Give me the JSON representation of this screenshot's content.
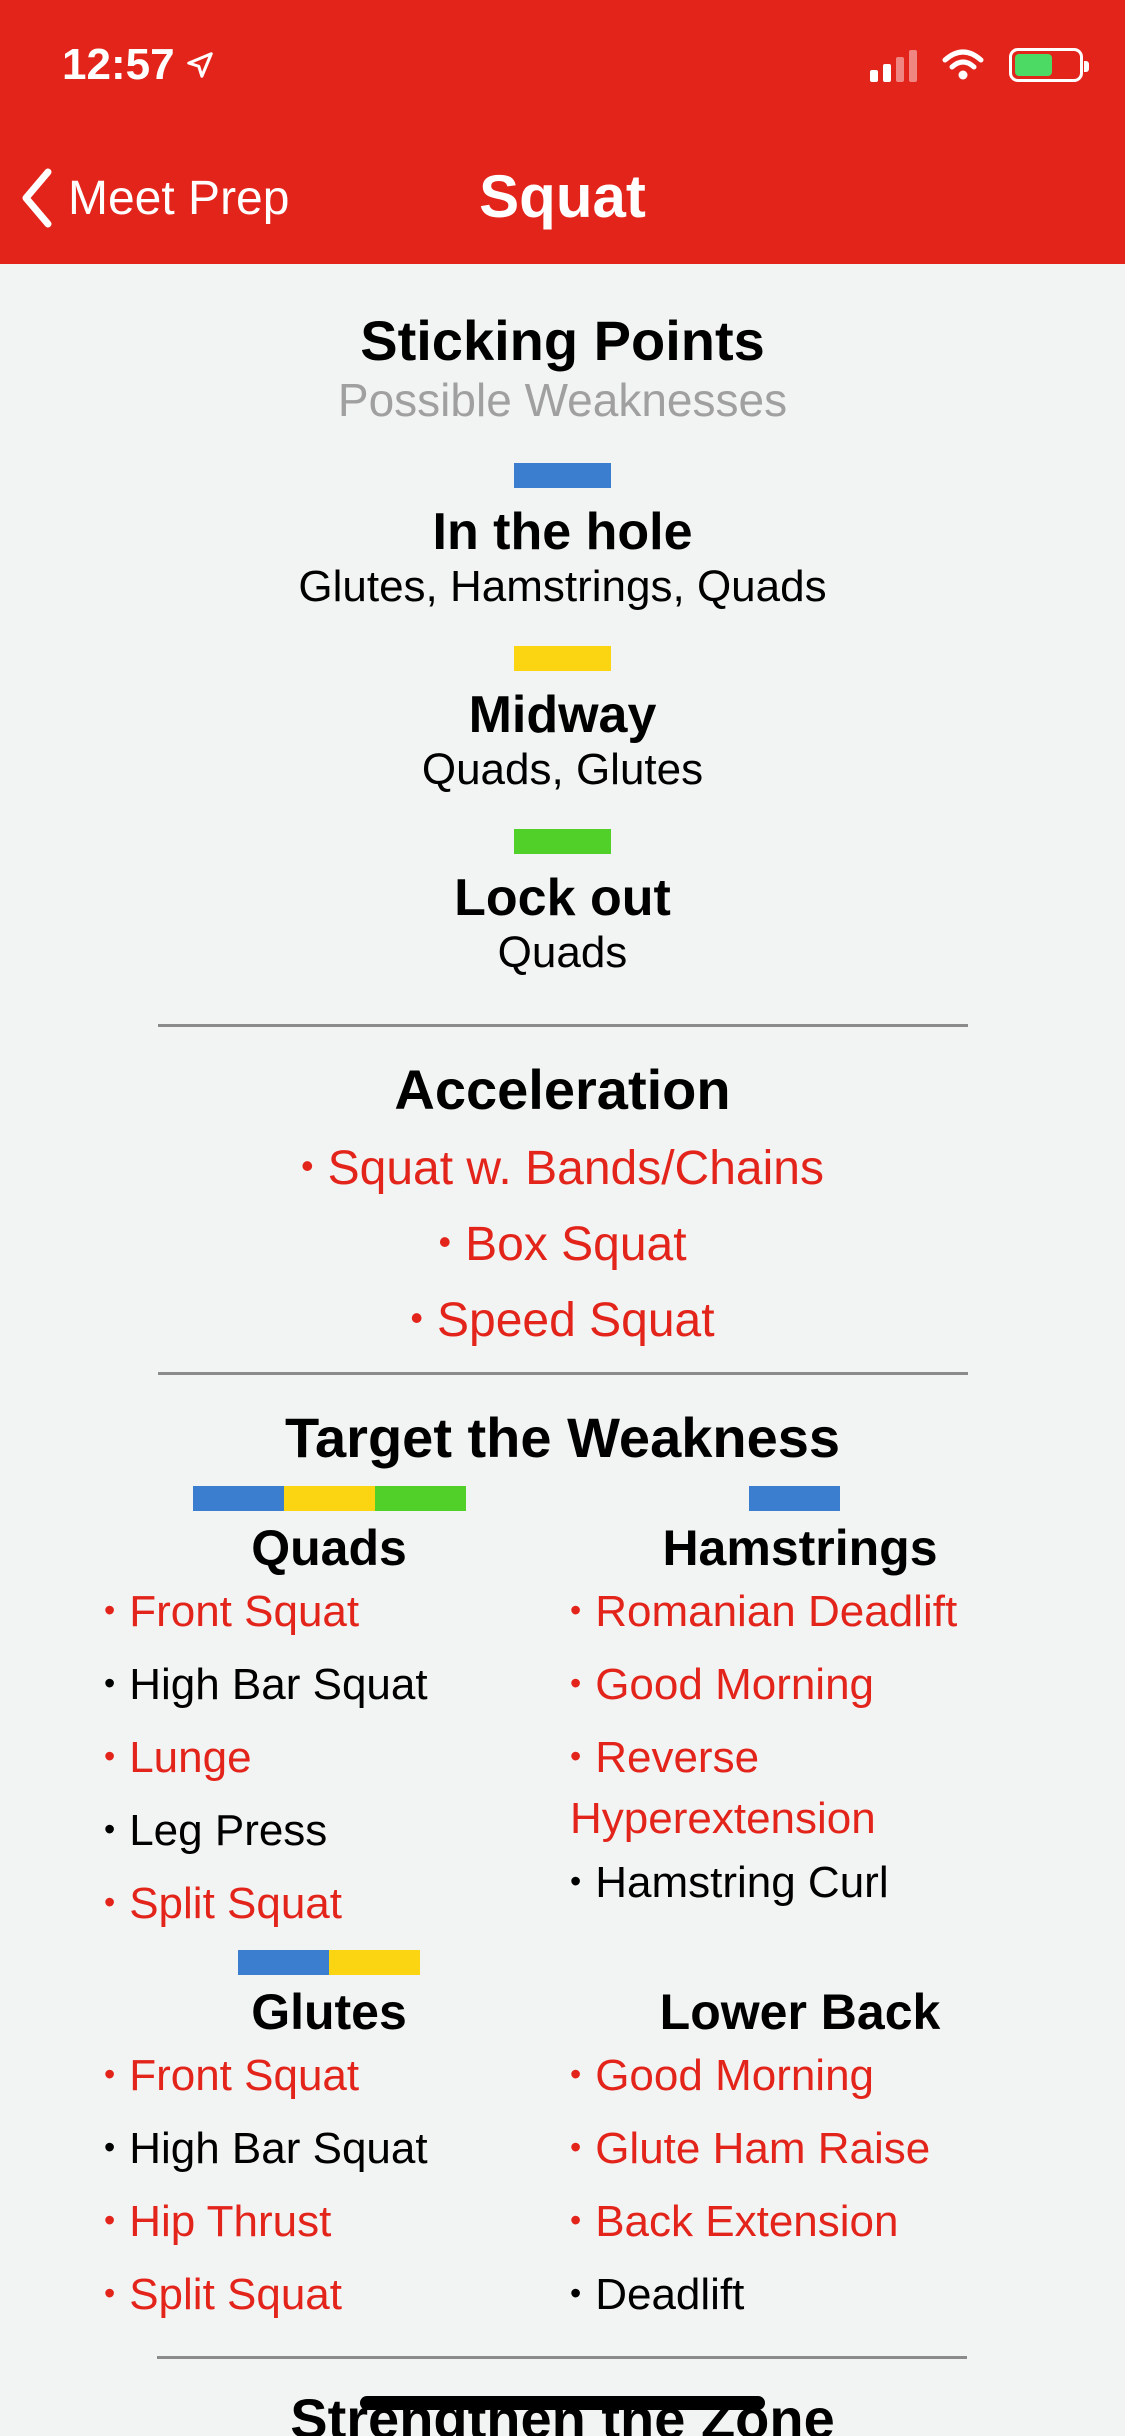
{
  "status_bar": {
    "time": "12:57"
  },
  "nav": {
    "back_label": "Meet Prep",
    "title": "Squat"
  },
  "sticking_points": {
    "title": "Sticking Points",
    "subtitle": "Possible Weaknesses",
    "phases": [
      {
        "name": "In the hole",
        "muscles": "Glutes, Hamstrings, Quads",
        "color": "#3b7dcf"
      },
      {
        "name": "Midway",
        "muscles": "Quads, Glutes",
        "color": "#fbd512"
      },
      {
        "name": "Lock out",
        "muscles": "Quads",
        "color": "#51d02a"
      }
    ]
  },
  "acceleration": {
    "title": "Acceleration",
    "items": [
      "Squat w. Bands/Chains",
      "Box Squat",
      "Speed Squat"
    ]
  },
  "target": {
    "title": "Target the Weakness",
    "quads": {
      "title": "Quads",
      "items": [
        "Front Squat",
        "High Bar Squat",
        "Lunge",
        "Leg Press",
        "Split Squat"
      ]
    },
    "hamstrings": {
      "title": "Hamstrings",
      "items": [
        "Romanian Deadlift",
        "Good Morning",
        "Reverse",
        "Hyperextension",
        "Hamstring Curl"
      ]
    },
    "glutes": {
      "title": "Glutes",
      "items": [
        "Front Squat",
        "High Bar Squat",
        "Hip Thrust",
        "Split Squat"
      ]
    },
    "lower_back": {
      "title": "Lower Back",
      "items": [
        "Good Morning",
        "Glute Ham Raise",
        "Back Extension",
        "Deadlift"
      ]
    }
  },
  "next_section": {
    "title": "Strengthen the Zone"
  },
  "colors": {
    "accent": "#e3241b",
    "blue": "#3b7dcf",
    "yellow": "#fbd512",
    "green": "#51d02a"
  }
}
